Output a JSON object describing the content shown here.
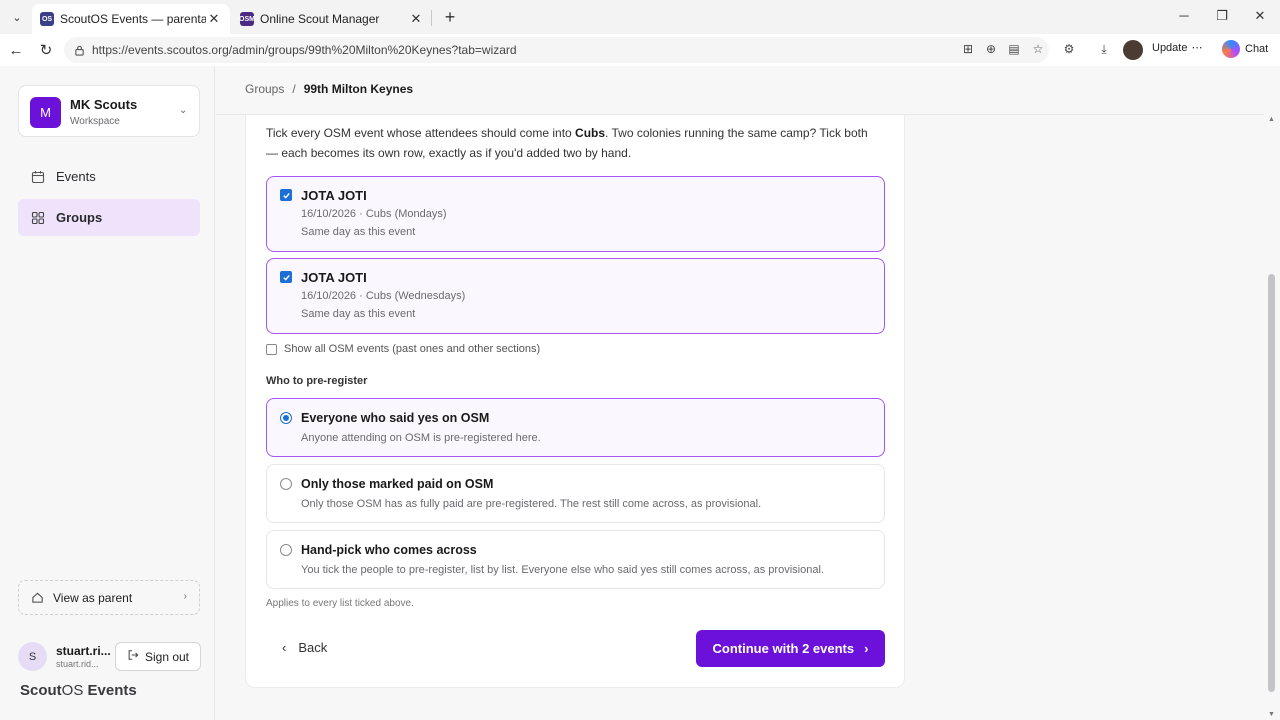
{
  "browser": {
    "tabs": [
      {
        "title": "ScoutOS Events — parental permi",
        "favicon": "OS",
        "active": true
      },
      {
        "title": "Online Scout Manager",
        "favicon": "OSM",
        "active": false
      }
    ],
    "url": "https://events.scoutos.org/admin/groups/99th%20Milton%20Keynes?tab=wizard",
    "update_label": "Update",
    "chat_label": "Chat"
  },
  "sidebar": {
    "workspace": {
      "initial": "M",
      "name": "MK Scouts",
      "subtitle": "Workspace"
    },
    "nav": [
      {
        "label": "Events",
        "icon": "calendar-icon",
        "active": false
      },
      {
        "label": "Groups",
        "icon": "grid-icon",
        "active": true
      }
    ],
    "view_as_parent": "View as parent",
    "user": {
      "initial": "S",
      "name": "stuart.ri...",
      "email": "stuart.rid..."
    },
    "sign_out": "Sign out",
    "brand": {
      "part1": "Scout",
      "part2": "OS",
      "part3": " Events"
    }
  },
  "breadcrumb": {
    "parent": "Groups",
    "separator": "/",
    "current": "99th Milton Keynes"
  },
  "wizard": {
    "intro_pre": "Tick every OSM event whose attendees should come into ",
    "intro_section": "Cubs",
    "intro_post": ". Two colonies running the same camp? Tick both — each becomes its own row, exactly as if you'd added two by hand.",
    "events": [
      {
        "title": "JOTA JOTI",
        "date": "16/10/2026 · Cubs (Mondays)",
        "note": "Same day as this event",
        "checked": true
      },
      {
        "title": "JOTA JOTI",
        "date": "16/10/2026 · Cubs (Wednesdays)",
        "note": "Same day as this event",
        "checked": true
      }
    ],
    "show_all_label": "Show all OSM events (past ones and other sections)",
    "preregister_heading": "Who to pre-register",
    "options": [
      {
        "title": "Everyone who said yes on OSM",
        "desc": "Anyone attending on OSM is pre-registered here.",
        "selected": true
      },
      {
        "title": "Only those marked paid on OSM",
        "desc": "Only those OSM has as fully paid are pre-registered. The rest still come across, as provisional.",
        "selected": false
      },
      {
        "title": "Hand-pick who comes across",
        "desc": "You tick the people to pre-register, list by list. Everyone else who said yes still comes across, as provisional.",
        "selected": false
      }
    ],
    "applies_note": "Applies to every list ticked above.",
    "back_label": "Back",
    "continue_label": "Continue with 2 events"
  },
  "colors": {
    "accent": "#6c11d9",
    "selected_border": "#a855f7",
    "checkbox": "#1b6fd6"
  }
}
